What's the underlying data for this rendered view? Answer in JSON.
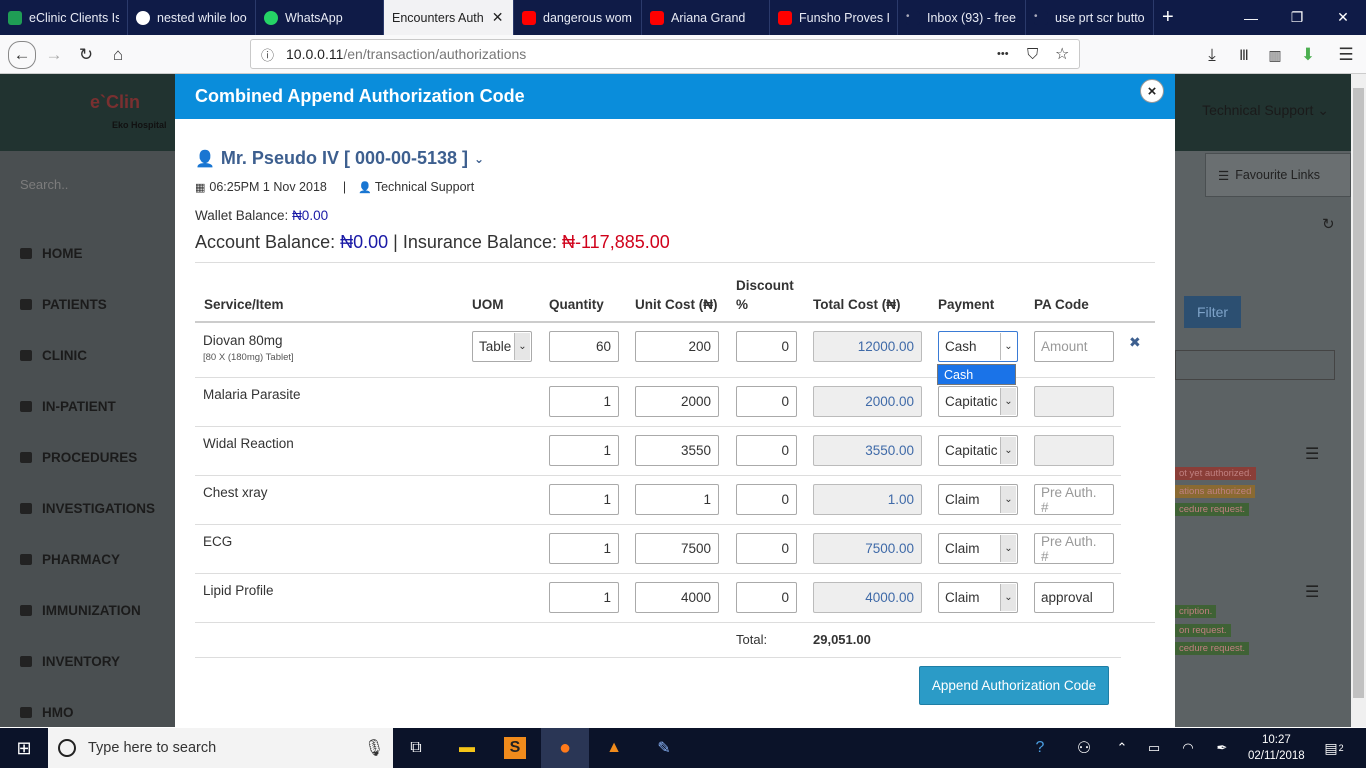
{
  "browser": {
    "tabs": [
      {
        "label": "eClinic Clients Is",
        "icon_color": "#1f9d55",
        "active": false
      },
      {
        "label": "nested while loo",
        "icon_color": "#ffffff",
        "active": false
      },
      {
        "label": "WhatsApp",
        "icon_color": "#25d366",
        "active": false
      },
      {
        "label": "Encounters Auth",
        "icon_color": "#f2f2f4",
        "active": true
      },
      {
        "label": "dangerous wom",
        "icon_color": "#ff0000",
        "active": false
      },
      {
        "label": "Ariana Grand",
        "icon_color": "#ff0000",
        "active": false
      },
      {
        "label": "Funsho Proves I",
        "icon_color": "#ff0000",
        "active": false
      },
      {
        "label": "Inbox (93) - free",
        "icon_color": "#3b5bdb",
        "active": false
      },
      {
        "label": "use prt scr butto",
        "icon_color": "#3b5bdb",
        "active": false
      }
    ],
    "url_host": "10.0.0.11",
    "url_path": "/en/transaction/authorizations",
    "url_dots": "•••"
  },
  "app": {
    "brand": "e`Clin",
    "brand_sub": "Eko Hospital",
    "user_menu": "Technical Support ⌄",
    "search_placeholder": "Search..",
    "fav_links": "Favourite Links",
    "filter_label": "Filter",
    "sidebar": [
      "HOME",
      "PATIENTS",
      "CLINIC",
      "IN-PATIENT",
      "PROCEDURES",
      "INVESTIGATIONS",
      "PHARMACY",
      "IMMUNIZATION",
      "INVENTORY",
      "HMO"
    ],
    "chips": [
      "ot yet authorized.",
      "ations authorized",
      "cedure request.",
      "cription.",
      "on request.",
      "cedure request."
    ]
  },
  "modal": {
    "title": "Combined Append Authorization Code",
    "close": "×",
    "patient_name": "Mr. Pseudo IV [ 000-00-5138 ]",
    "datetime": "06:25PM 1 Nov 2018",
    "separator": "|",
    "user": "Technical Support",
    "wallet_label": "Wallet Balance:",
    "wallet_value": "₦0.00",
    "account_label": "Account Balance:",
    "account_value": "₦0.00",
    "pipe": "|",
    "insurance_label": "Insurance Balance:",
    "insurance_value": "₦-117,885.00",
    "columns": {
      "service": "Service/Item",
      "uom": "UOM",
      "quantity": "Quantity",
      "unit_cost": "Unit Cost (₦)",
      "discount_1": "Discount",
      "discount_2": "%",
      "total_cost": "Total Cost (₦)",
      "payment": "Payment",
      "pa_code": "PA Code"
    },
    "rows": [
      {
        "service": "Diovan 80mg",
        "detail": "[80 X (180mg) Tablet]",
        "uom": "Table",
        "quantity": "60",
        "unit_cost": "200",
        "discount": "0",
        "total": "12000.00",
        "payment": "Cash",
        "pa_code": "",
        "pa_placeholder": "Amount"
      },
      {
        "service": "Malaria Parasite",
        "quantity": "1",
        "unit_cost": "2000",
        "discount": "0",
        "total": "2000.00",
        "payment": "Capitatic",
        "pa_code": "",
        "pa_placeholder": ""
      },
      {
        "service": "Widal Reaction",
        "quantity": "1",
        "unit_cost": "3550",
        "discount": "0",
        "total": "3550.00",
        "payment": "Capitatic",
        "pa_code": "",
        "pa_placeholder": ""
      },
      {
        "service": "Chest xray",
        "quantity": "1",
        "unit_cost": "1",
        "discount": "0",
        "total": "1.00",
        "payment": "Claim",
        "pa_code": "",
        "pa_placeholder": "Pre Auth. #"
      },
      {
        "service": "ECG",
        "quantity": "1",
        "unit_cost": "7500",
        "discount": "0",
        "total": "7500.00",
        "payment": "Claim",
        "pa_code": "",
        "pa_placeholder": "Pre Auth. #"
      },
      {
        "service": "Lipid Profile",
        "quantity": "1",
        "unit_cost": "4000",
        "discount": "0",
        "total": "4000.00",
        "payment": "Claim",
        "pa_code": "approval",
        "pa_placeholder": ""
      }
    ],
    "dropdown_option": "Cash",
    "remove_icon": "✖",
    "total_label": "Total:",
    "total_value": "29,051.00",
    "append_button": "Append Authorization Code"
  },
  "taskbar": {
    "search_placeholder": "Type here to search",
    "time": "10:27",
    "date": "02/11/2018",
    "notifications": "2"
  },
  "colors": {
    "modal_header": "#0a8ddb",
    "append_button": "#2b9bc7",
    "insurance_negative": "#d0021b"
  }
}
